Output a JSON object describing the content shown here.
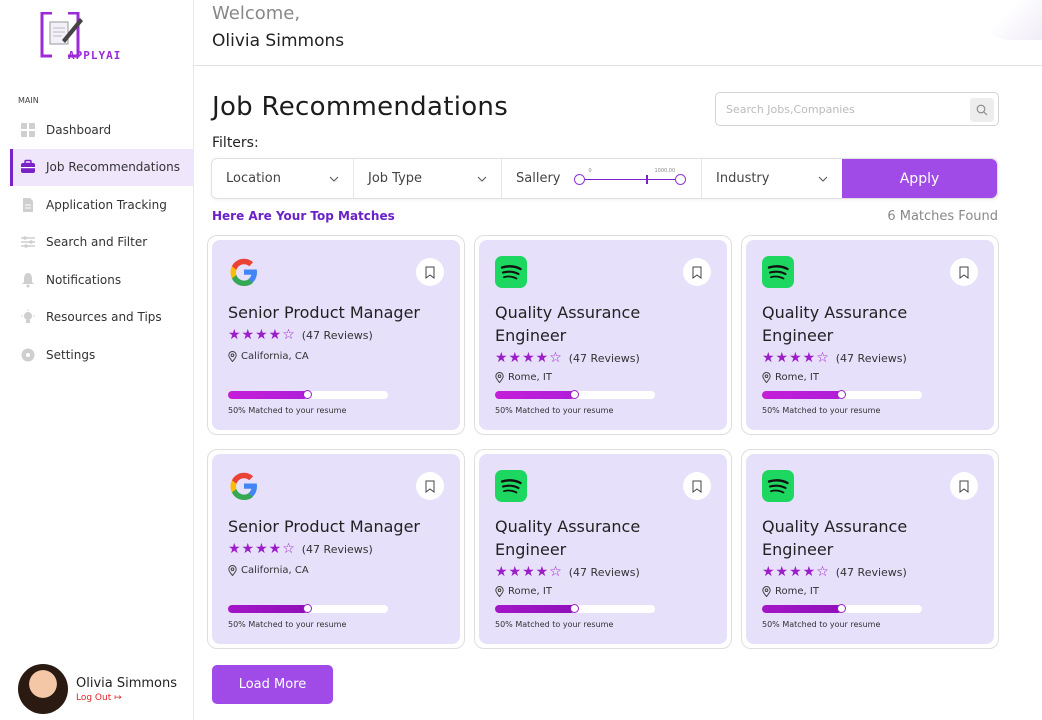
{
  "brand": {
    "logo_text": "APPLYAI"
  },
  "sidebar": {
    "section_label": "MAIN",
    "items": [
      {
        "label": "Dashboard",
        "icon": "dashboard-icon"
      },
      {
        "label": "Job Recommendations",
        "icon": "briefcase-icon",
        "active": true
      },
      {
        "label": "Application Tracking",
        "icon": "document-icon"
      },
      {
        "label": "Search and Filter",
        "icon": "filter-icon"
      },
      {
        "label": "Notifications",
        "icon": "bell-icon"
      },
      {
        "label": "Resources and Tips",
        "icon": "lightbulb-icon"
      },
      {
        "label": "Settings",
        "icon": "settings-icon"
      }
    ],
    "profile": {
      "name": "Olivia Simmons",
      "logout_label": "Log Out"
    }
  },
  "header": {
    "welcome": "Welcome,",
    "username": "Olivia Simmons"
  },
  "main": {
    "title": "Job Recommendations",
    "search_placeholder": "Search Jobs,Companies",
    "filters_label": "Filters:",
    "filters": {
      "location": "Location",
      "job_type": "Job Type",
      "salary": "Sallery",
      "salary_min": "0",
      "salary_max": "1000,00",
      "industry": "Industry",
      "apply": "Apply"
    },
    "top_matches_label": "Here Are Your Top Matches",
    "matches_found": "6 Matches Found",
    "load_more": "Load More"
  },
  "jobs": [
    {
      "company": "google",
      "title": "Senior Product Manager",
      "reviews": "(47 Reviews)",
      "rating": 4,
      "location": "California, CA",
      "match_fraction": 0.5,
      "match_text": "50% Matched to your resume"
    },
    {
      "company": "spotify",
      "title": "Quality Assurance Engineer",
      "reviews": "(47 Reviews)",
      "rating": 4,
      "location": "Rome, IT",
      "match_fraction": 0.5,
      "match_text": "50% Matched to your resume"
    },
    {
      "company": "spotify",
      "title": "Quality Assurance Engineer",
      "reviews": "(47 Reviews)",
      "rating": 4,
      "location": "Rome, IT",
      "match_fraction": 0.5,
      "match_text": "50% Matched to your resume"
    },
    {
      "company": "google",
      "title": "Senior Product Manager",
      "reviews": "(47 Reviews)",
      "rating": 4,
      "location": "California, CA",
      "match_fraction": 0.5,
      "match_text": "50% Matched to your resume"
    },
    {
      "company": "spotify",
      "title": "Quality Assurance Engineer",
      "reviews": "(47 Reviews)",
      "rating": 4,
      "location": "Rome, IT",
      "match_fraction": 0.5,
      "match_text": "50% Matched to your resume"
    },
    {
      "company": "spotify",
      "title": "Quality Assurance Engineer",
      "reviews": "(47 Reviews)",
      "rating": 4,
      "location": "Rome, IT",
      "match_fraction": 0.5,
      "match_text": "50% Matched to your resume"
    }
  ],
  "colors": {
    "accent": "#a04ae8",
    "card_bg": "#e6e0fb",
    "star": "#9b1ec8",
    "spotify": "#1ed760"
  }
}
